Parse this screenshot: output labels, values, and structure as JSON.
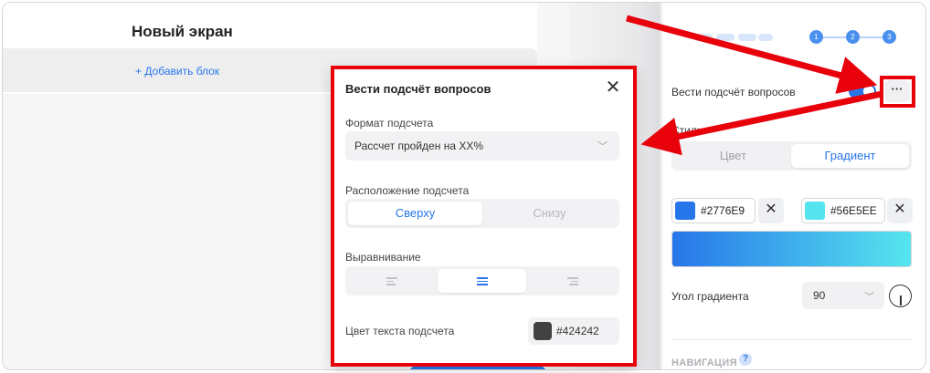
{
  "canvas": {
    "screen_title": "Новый экран",
    "add_block": "+ Добавить блок"
  },
  "right_panel": {
    "steps": [
      "1",
      "2",
      "3"
    ],
    "count_label": "Вести подсчёт вопросов",
    "count_enabled": true,
    "more_label": "···",
    "style_label": "Стиль",
    "style_options": [
      "Цвет",
      "Градиент"
    ],
    "style_selected": "Градиент",
    "color_from": {
      "hex": "#2776E9",
      "swatch": "#2776e9"
    },
    "color_to": {
      "hex": "#56E5EE",
      "swatch": "#56e5ee"
    },
    "clear_label": "✕",
    "angle_label": "Угол градиента",
    "angle_value": "90",
    "nav_label": "НАВИГАЦИЯ",
    "help_label": "?"
  },
  "popup": {
    "title": "Вести подсчёт вопросов",
    "close_label": "✕",
    "format_label": "Формат подсчета",
    "format_value": "Рассчет пройден на ХХ%",
    "position_label": "Расположение подсчета",
    "position_options": [
      "Сверху",
      "Снизу"
    ],
    "position_selected": "Сверху",
    "align_label": "Выравнивание",
    "align_options": [
      "left",
      "center",
      "right"
    ],
    "align_selected": "center",
    "text_color_label": "Цвет текста подсчета",
    "text_color": "#424242"
  },
  "annotation_color": "#e8000b"
}
